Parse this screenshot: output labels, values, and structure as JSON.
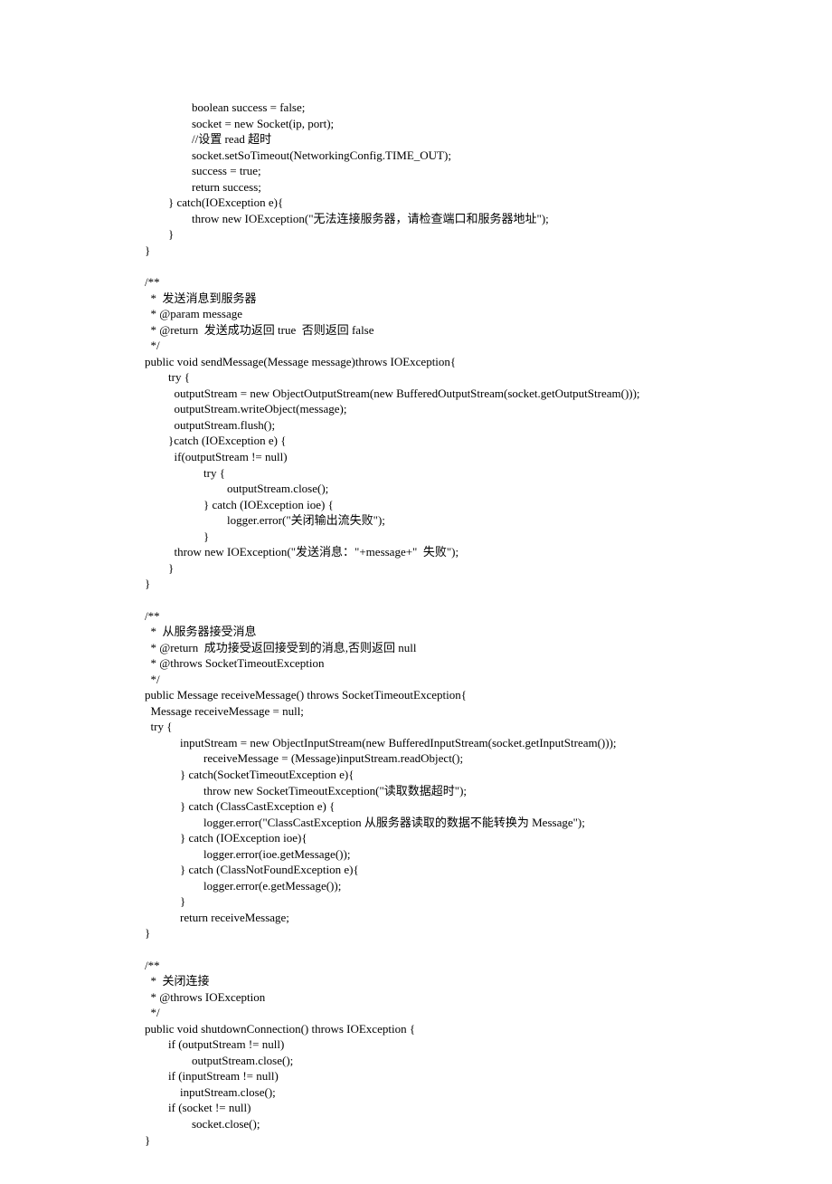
{
  "code": {
    "lines": [
      "                boolean success = false;",
      "                socket = new Socket(ip, port);",
      "                //设置 read 超时",
      "                socket.setSoTimeout(NetworkingConfig.TIME_OUT);",
      "                success = true;",
      "                return success;",
      "        } catch(IOException e){",
      "                throw new IOException(\"无法连接服务器，请检查端口和服务器地址\");",
      "        }",
      "}",
      "",
      "/**",
      "  *  发送消息到服务器",
      "  * @param message",
      "  * @return  发送成功返回 true  否则返回 false",
      "  */",
      "public void sendMessage(Message message)throws IOException{",
      "        try {",
      "          outputStream = new ObjectOutputStream(new BufferedOutputStream(socket.getOutputStream()));",
      "          outputStream.writeObject(message);",
      "          outputStream.flush();",
      "        }catch (IOException e) {",
      "          if(outputStream != null)",
      "                    try {",
      "                            outputStream.close();",
      "                    } catch (IOException ioe) {",
      "                            logger.error(\"关闭输出流失败\");",
      "                    }",
      "          throw new IOException(\"发送消息：\"+message+\"  失败\");",
      "        }",
      "}",
      "",
      "/**",
      "  *  从服务器接受消息",
      "  * @return  成功接受返回接受到的消息,否则返回 null",
      "  * @throws SocketTimeoutException",
      "  */",
      "public Message receiveMessage() throws SocketTimeoutException{",
      "  Message receiveMessage = null;",
      "  try {",
      "            inputStream = new ObjectInputStream(new BufferedInputStream(socket.getInputStream()));",
      "                    receiveMessage = (Message)inputStream.readObject();",
      "            } catch(SocketTimeoutException e){",
      "                    throw new SocketTimeoutException(\"读取数据超时\");",
      "            } catch (ClassCastException e) {",
      "                    logger.error(\"ClassCastException 从服务器读取的数据不能转换为 Message\");",
      "            } catch (IOException ioe){",
      "                    logger.error(ioe.getMessage());",
      "            } catch (ClassNotFoundException e){",
      "                    logger.error(e.getMessage());",
      "            }",
      "            return receiveMessage;",
      "}",
      "",
      "/**",
      "  *  关闭连接",
      "  * @throws IOException",
      "  */",
      "public void shutdownConnection() throws IOException {",
      "        if (outputStream != null)",
      "                outputStream.close();",
      "        if (inputStream != null)",
      "            inputStream.close();",
      "        if (socket != null)",
      "                socket.close();",
      "}"
    ]
  }
}
